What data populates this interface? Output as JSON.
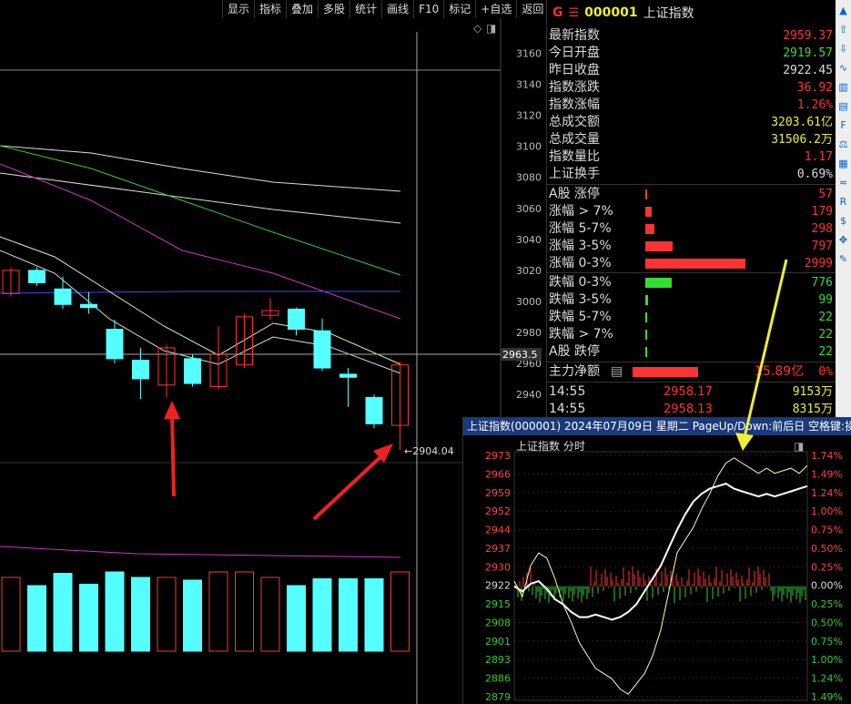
{
  "toolbar": {
    "items": [
      "显示",
      "指标",
      "叠加",
      "多股",
      "统计",
      "画线",
      "F10",
      "标记",
      "+自选",
      "返回"
    ]
  },
  "kchart": {
    "price_labels": [
      "3160",
      "3140",
      "3120",
      "3100",
      "3080",
      "3060",
      "3040",
      "3020",
      "3000",
      "2980",
      "2960",
      "2940"
    ],
    "crosshair_price": "2963.5",
    "low_label": "2904.04"
  },
  "chart_data": {
    "type": "candlestick",
    "ylim": [
      2930,
      3168
    ],
    "candles": [
      {
        "o": 3005,
        "c": 3020,
        "h": 3022,
        "l": 3003,
        "up": true
      },
      {
        "o": 3020,
        "c": 3012,
        "h": 3022,
        "l": 3010,
        "up": false
      },
      {
        "o": 3008,
        "c": 2998,
        "h": 3016,
        "l": 2995,
        "up": false
      },
      {
        "o": 2998,
        "c": 2996,
        "h": 3006,
        "l": 2992,
        "up": false
      },
      {
        "o": 2982,
        "c": 2963,
        "h": 2988,
        "l": 2960,
        "up": false
      },
      {
        "o": 2962,
        "c": 2950,
        "h": 2970,
        "l": 2937,
        "up": false
      },
      {
        "o": 2946,
        "c": 2970,
        "h": 2972,
        "l": 2938,
        "up": true
      },
      {
        "o": 2963,
        "c": 2947,
        "h": 2966,
        "l": 2945,
        "up": false
      },
      {
        "o": 2945,
        "c": 2966,
        "h": 2984,
        "l": 2943,
        "up": true
      },
      {
        "o": 2959,
        "c": 2990,
        "h": 2992,
        "l": 2957,
        "up": true
      },
      {
        "o": 2991,
        "c": 2994,
        "h": 3002,
        "l": 2988,
        "up": true
      },
      {
        "o": 2995,
        "c": 2982,
        "h": 2996,
        "l": 2978,
        "up": false
      },
      {
        "o": 2981,
        "c": 2957,
        "h": 2989,
        "l": 2955,
        "up": false
      },
      {
        "o": 2953,
        "c": 2951,
        "h": 2957,
        "l": 2932,
        "up": false
      },
      {
        "o": 2938,
        "c": 2921,
        "h": 2940,
        "l": 2918,
        "up": false
      },
      {
        "o": 2920,
        "c": 2959,
        "h": 2961,
        "l": 2904,
        "up": true
      }
    ],
    "volumes": [
      0.54,
      0.48,
      0.57,
      0.49,
      0.58,
      0.54,
      0.54,
      0.52,
      0.58,
      0.58,
      0.54,
      0.48,
      0.53,
      0.53,
      0.53,
      0.58
    ],
    "volume_up": [
      true,
      false,
      false,
      false,
      false,
      false,
      true,
      false,
      true,
      true,
      true,
      false,
      false,
      false,
      false,
      true
    ]
  },
  "panel": {
    "g": "G",
    "menu": "☰",
    "code": "000001",
    "name": "上证指数",
    "rows": [
      {
        "label": "最新指数",
        "value": "2959.37",
        "color": "#f33"
      },
      {
        "label": "今日开盘",
        "value": "2919.57",
        "color": "#3d3"
      },
      {
        "label": "昨日收盘",
        "value": "2922.45",
        "color": "#ddd"
      },
      {
        "label": "指数涨跌",
        "value": "36.92",
        "color": "#f33"
      },
      {
        "label": "指数涨幅",
        "value": "1.26%",
        "color": "#f33"
      },
      {
        "label": "总成交额",
        "value": "3203.61亿",
        "color": "#ee3"
      },
      {
        "label": "总成交量",
        "value": "31506.2万",
        "color": "#ee3"
      },
      {
        "label": "指数量比",
        "value": "1.17",
        "color": "#f33"
      },
      {
        "label": "上证换手",
        "value": "0.69%",
        "color": "#ddd"
      }
    ],
    "dist": [
      {
        "label": "A股 涨停",
        "value": "57",
        "color": "#f33",
        "bar": 0.02
      },
      {
        "label": "涨幅 > 7%",
        "value": "179",
        "color": "#f33",
        "bar": 0.06
      },
      {
        "label": "涨幅 5-7%",
        "value": "298",
        "color": "#f33",
        "bar": 0.09
      },
      {
        "label": "涨幅 3-5%",
        "value": "797",
        "color": "#f33",
        "bar": 0.27
      },
      {
        "label": "涨幅 0-3%",
        "value": "2999",
        "color": "#f33",
        "bar": 1.0
      },
      {
        "label": "跌幅 0-3%",
        "value": "776",
        "color": "#3d3",
        "bar": 0.26
      },
      {
        "label": "跌幅 3-5%",
        "value": "99",
        "color": "#3d3",
        "bar": 0.03
      },
      {
        "label": "跌幅 5-7%",
        "value": "22",
        "color": "#3d3",
        "bar": 0.01
      },
      {
        "label": "跌幅 > 7%",
        "value": "22",
        "color": "#3d3",
        "bar": 0.01
      },
      {
        "label": "A股 跌停",
        "value": "22",
        "color": "#3d3",
        "bar": 0.01
      }
    ],
    "mainforce": {
      "label": "主力净额",
      "value": "15.89亿",
      "pct": "0%"
    },
    "ticks": [
      {
        "time": "14:55",
        "price": "2958.17",
        "vol": "9153万"
      },
      {
        "time": "14:55",
        "price": "2958.13",
        "vol": "8315万"
      }
    ]
  },
  "icons": [
    "up-arrow",
    "up-icon",
    "down-icon",
    "chart-icon",
    "candle-icon",
    "table-icon",
    "f10-icon",
    "finance-icon",
    "chart2-icon",
    "wave-icon",
    "rs-icon",
    "dollar-icon",
    "move-icon",
    "pen-icon"
  ],
  "mini": {
    "title": "上证指数(000001) 2024年07月09日 星期二 PageUp/Down:前后日 空格键:操作",
    "label": "上证指数  分时",
    "left_prices": [
      "2973",
      "2966",
      "2959",
      "2952",
      "2944",
      "2937",
      "2930",
      "2922",
      "2915",
      "2908",
      "2901",
      "2893",
      "2886",
      "2879"
    ],
    "right_pcts": [
      "1.74%",
      "1.49%",
      "1.24%",
      "1.00%",
      "0.75%",
      "0.50%",
      "0.25%",
      "0.00%",
      "0.25%",
      "0.50%",
      "0.75%",
      "1.00%",
      "1.24%",
      "1.49%"
    ],
    "yellow_line": [
      2924,
      2918,
      2930,
      2935,
      2933,
      2925,
      2915,
      2908,
      2900,
      2895,
      2890,
      2888,
      2886,
      2882,
      2880,
      2884,
      2888,
      2895,
      2905,
      2920,
      2935,
      2940,
      2945,
      2952,
      2958,
      2965,
      2970,
      2972,
      2970,
      2968,
      2966,
      2968,
      2966,
      2967,
      2968,
      2966,
      2969
    ],
    "white_line": [
      2922,
      2920,
      2923,
      2924,
      2921,
      2917,
      2915,
      2912,
      2910,
      2910,
      2911,
      2910,
      2909,
      2910,
      2912,
      2915,
      2920,
      2925,
      2930,
      2937,
      2944,
      2950,
      2955,
      2958,
      2960,
      2961,
      2962,
      2960,
      2959,
      2958,
      2957,
      2958,
      2957,
      2958,
      2959,
      2960,
      2961
    ]
  }
}
